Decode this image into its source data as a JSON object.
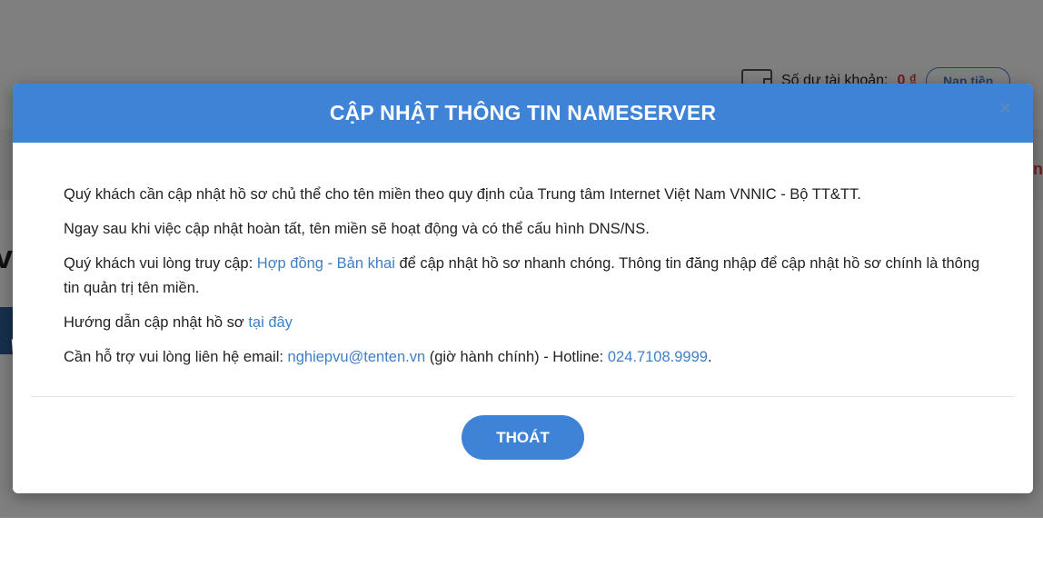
{
  "background": {
    "balance_label": "Số dư tài khoản:",
    "balance_amount": "0 ₫",
    "topup_label": "Nạp tiền"
  },
  "modal": {
    "title": "CẬP NHẬT THÔNG TIN NAMESERVER",
    "close_symbol": "×",
    "paragraphs": {
      "p1": "Quý khách cần cập nhật hồ sơ chủ thể cho tên miền theo quy định của Trung tâm Internet Việt Nam VNNIC - Bộ TT&TT.",
      "p2": "Ngay sau khi việc cập nhật hoàn tất, tên miền sẽ hoạt động và có thể cấu hình DNS/NS.",
      "p3_prefix": "Quý khách vui lòng truy cập: ",
      "p3_link": "Hợp đồng - Bản khai",
      "p3_suffix": " để cập nhật hồ sơ nhanh chóng. Thông tin đăng nhập để cập nhật hồ sơ chính là thông tin quản trị tên miền.",
      "p4_prefix": "Hướng dẫn cập nhật hồ sơ ",
      "p4_link": "tại đây",
      "p5_prefix": "Cần hỗ trợ vui lòng liên hệ email: ",
      "p5_email": "nghiepvu@tenten.vn",
      "p5_middle": " (giờ hành chính) - Hotline: ",
      "p5_hotline": "024.7108.9999",
      "p5_suffix": "."
    },
    "exit_button_label": "THOÁT"
  },
  "colors": {
    "header_blue": "#3f83d6",
    "link_blue": "#3f7fc8",
    "balance_red": "#e53935"
  }
}
